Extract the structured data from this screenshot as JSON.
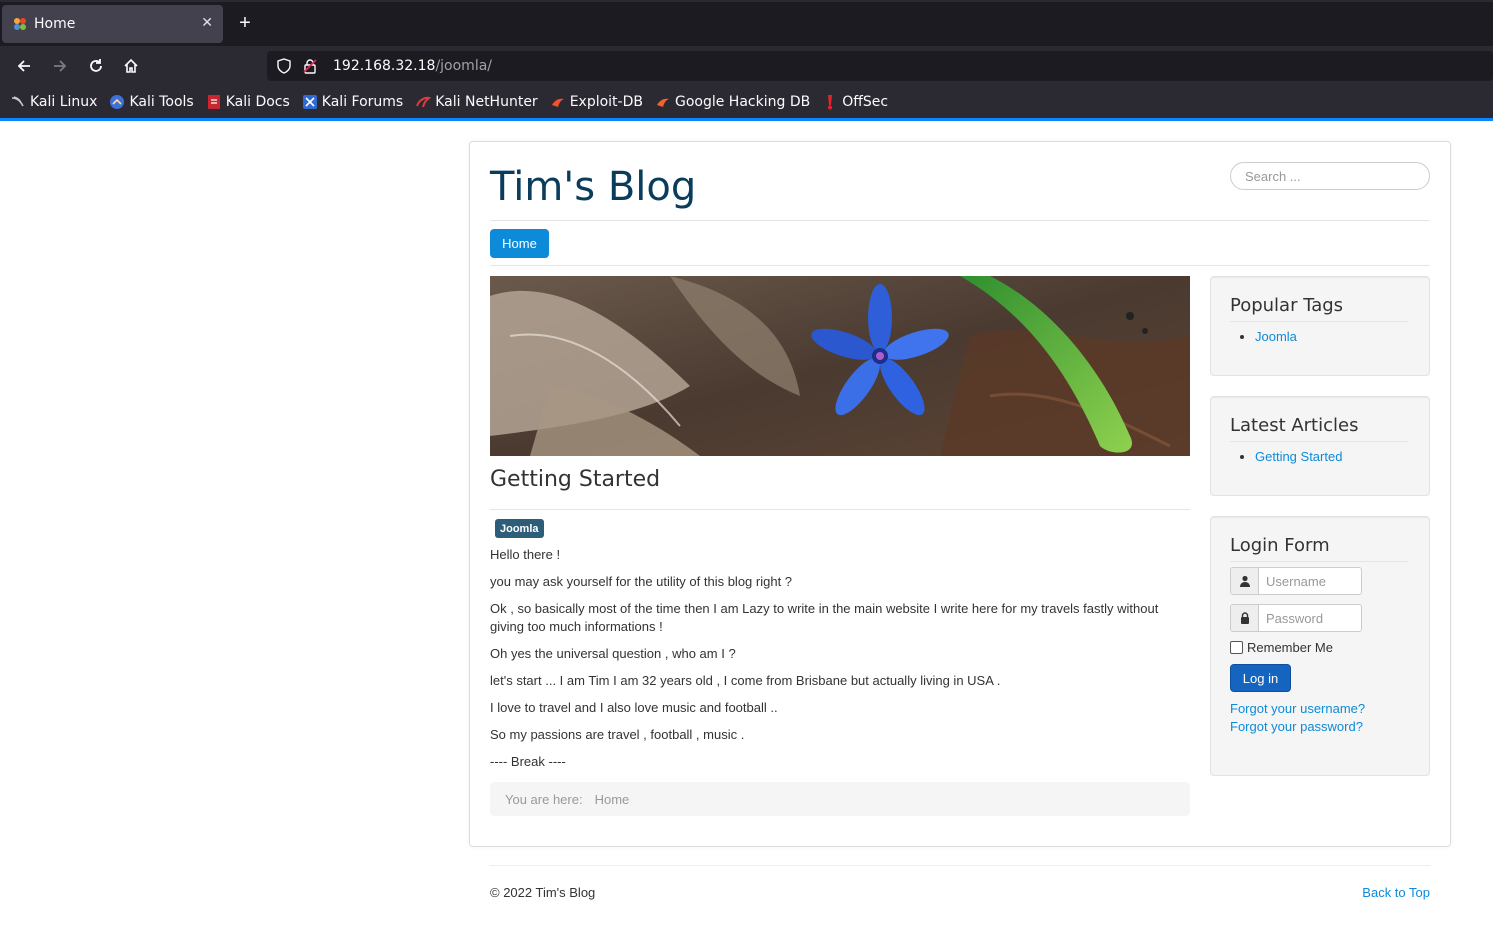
{
  "browser": {
    "tab_title": "Home",
    "url_host": "192.168.32.18",
    "url_path": "/joomla/",
    "bookmarks": [
      {
        "label": "Kali Linux",
        "icon": "kali-dragon-icon"
      },
      {
        "label": "Kali Tools",
        "icon": "kali-tools-icon"
      },
      {
        "label": "Kali Docs",
        "icon": "kali-docs-icon"
      },
      {
        "label": "Kali Forums",
        "icon": "kali-forums-icon"
      },
      {
        "label": "Kali NetHunter",
        "icon": "kali-nethunter-icon"
      },
      {
        "label": "Exploit-DB",
        "icon": "exploit-db-icon"
      },
      {
        "label": "Google Hacking DB",
        "icon": "ghdb-icon"
      },
      {
        "label": "OffSec",
        "icon": "offsec-icon"
      }
    ],
    "accent_color": "#0a84ff"
  },
  "site": {
    "title": "Tim's Blog",
    "search_placeholder": "Search ...",
    "nav_home": "Home"
  },
  "article": {
    "title": "Getting Started",
    "tag": "Joomla",
    "paragraphs": [
      "Hello there  !",
      "you may ask yourself for the utility of this blog right ?",
      "Ok , so basically most of  the time then I am Lazy to write in the main website I write here for my travels fastly without giving too much informations !",
      "Oh yes the universal question , who am I ?",
      "let's start ... I am Tim I am 32 years old ,  I come from Brisbane but actually living in USA .",
      "I love to travel and I also love music and football ..",
      "So my passions are travel , football , music .",
      "---- Break ----"
    ]
  },
  "breadcrumb": {
    "label": "You are here:",
    "current": "Home"
  },
  "sidebar": {
    "popular_tags": {
      "title": "Popular Tags",
      "items": [
        "Joomla"
      ]
    },
    "latest_articles": {
      "title": "Latest Articles",
      "items": [
        "Getting Started"
      ]
    },
    "login": {
      "title": "Login Form",
      "username_placeholder": "Username",
      "password_placeholder": "Password",
      "remember_label": "Remember Me",
      "login_label": "Log in",
      "forgot_username": "Forgot your username?",
      "forgot_password": "Forgot your password?"
    }
  },
  "footer": {
    "copyright": "© 2022 Tim's Blog",
    "back_to_top": "Back to Top"
  }
}
